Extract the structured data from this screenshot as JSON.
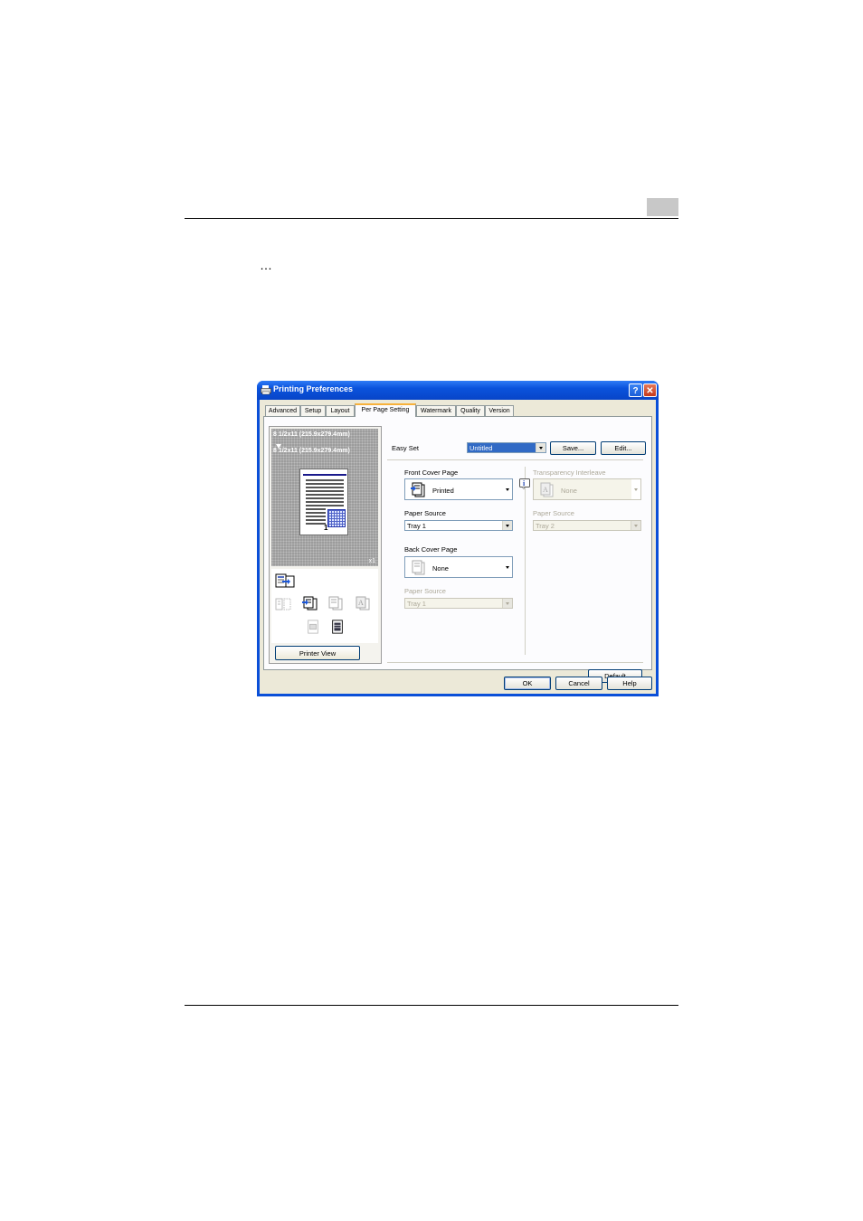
{
  "page": {
    "ellipsis": "…"
  },
  "dialog": {
    "title": "Printing Preferences",
    "title_help": "?",
    "title_close": "✕",
    "tabs": [
      {
        "label": "Advanced",
        "active": false
      },
      {
        "label": "Setup",
        "active": false
      },
      {
        "label": "Layout",
        "active": false
      },
      {
        "label": "Per Page Setting",
        "active": true
      },
      {
        "label": "Watermark",
        "active": false
      },
      {
        "label": "Quality",
        "active": false
      },
      {
        "label": "Version",
        "active": false
      }
    ],
    "preview": {
      "original_paper": "8 1/2x11 (215.9x279.4mm)",
      "output_paper": "8 1/2x11 (215.9x279.4mm)",
      "copies": "x1",
      "page_number": "1",
      "printer_view_button": "Printer View"
    },
    "easy_set": {
      "label": "Easy Set",
      "value": "Untitled",
      "save_button": "Save...",
      "edit_button": "Edit..."
    },
    "front_cover": {
      "label": "Front Cover Page",
      "value": "Printed",
      "icon": "front-cover-icon",
      "paper_source_label": "Paper Source",
      "paper_source_value": "Tray 1"
    },
    "back_cover": {
      "label": "Back Cover Page",
      "value": "None",
      "icon": "back-cover-icon",
      "paper_source_label": "Paper Source",
      "paper_source_value": "Tray 1"
    },
    "transparency": {
      "label": "Transparency Interleave",
      "value": "None",
      "paper_source_label": "Paper Source",
      "paper_source_value": "Tray 2"
    },
    "default_button": "Default",
    "ok_button": "OK",
    "cancel_button": "Cancel",
    "help_button": "Help"
  },
  "colors": {
    "title_bar": "#0a52dc",
    "dialog_bg": "#ece9d8",
    "selection": "#316ac5",
    "chapter_box": "#c8c8c8"
  }
}
